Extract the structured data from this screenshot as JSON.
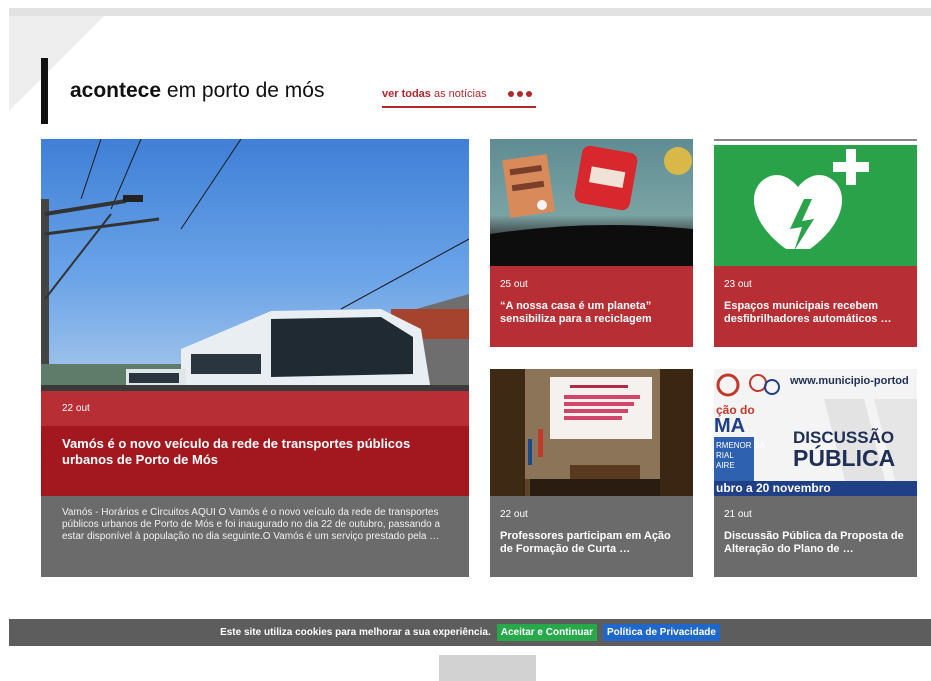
{
  "section": {
    "heading_bold": "acontece",
    "heading_rest": "em porto de mós",
    "see_all_bold": "ver todas",
    "see_all_rest": "as notícias"
  },
  "featured": {
    "date": "22 out",
    "title": "Vamós é o novo veículo da rede de transportes públicos urbanos de Porto de Mós",
    "excerpt": "Vamós - Horários e Circuitos AQUI O Vamós é o novo veículo da rede de transportes públicos urbanos de Porto de Mós e foi inaugurado no dia 22 de outubro, passando a estar disponível à população no dia seguinte.O Vamós é um serviço prestado pela …",
    "image_icon": "bus-photo"
  },
  "news": [
    {
      "date": "25 out",
      "title": "“A nossa casa é um planeta” sensibiliza para a reciclagem",
      "image_icon": "recycling-stage-photo"
    },
    {
      "date": "23 out",
      "title": "Espaços municipais recebem desfibrilhadores automáticos …",
      "image_icon": "defibrillator-heart-icon"
    },
    {
      "date": "22 out",
      "title": "Professores participam em Ação de Formação de Curta …",
      "image_icon": "auditorium-photo"
    },
    {
      "date": "21 out",
      "title": "Discussão Pública da Proposta de Alteração do Plano de …",
      "image_icon": "public-discussion-poster"
    }
  ],
  "poster": {
    "url_text": "www.municipio-portod",
    "line1": "DISCUSSÃO",
    "line2": "PÚBLICA",
    "left1": "ção do",
    "left2": "MA",
    "left3": "RMENOR DA",
    "left4": "RIAL",
    "left5": "AIRE",
    "dates": "ubro a 20 novembro"
  },
  "cookies": {
    "text": "Este site utiliza cookies para melhorar a sua experiência.",
    "accept_label": "Aceitar e Continuar",
    "privacy_label": "Política de Privacidade"
  },
  "colors": {
    "accent_red": "#b5262b",
    "card_red": "#b72f35",
    "title_red": "#a3181f",
    "card_gray": "#6b6b6b",
    "accept_green": "#27a84a",
    "privacy_blue": "#1f67c8",
    "aed_green": "#2aa24a"
  }
}
